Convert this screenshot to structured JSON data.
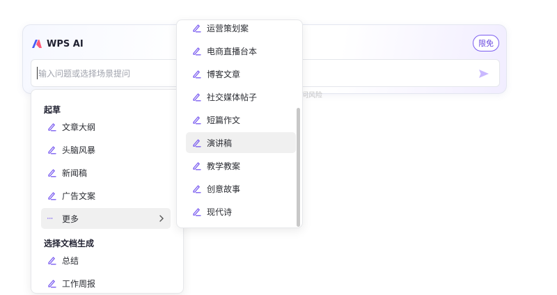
{
  "panel": {
    "brand": "WPS AI",
    "badge": "限免",
    "input_placeholder": "输入问题或选择场景提问",
    "hint_fragment": "问风险"
  },
  "main_menu": {
    "section1_title": "起草",
    "items": [
      "文章大纲",
      "头脑风暴",
      "新闻稿",
      "广告文案"
    ],
    "more_label": "更多",
    "section2_title": "选择文档生成",
    "doc_items": [
      "总结",
      "工作周报"
    ]
  },
  "sub_menu": {
    "items": [
      "运营策划案",
      "电商直播台本",
      "博客文章",
      "社交媒体帖子",
      "短篇作文",
      "演讲稿",
      "教学教案",
      "创意故事",
      "现代诗"
    ],
    "highlighted_index": 5
  },
  "colors": {
    "accent": "#7a5cf0",
    "send_icon": "#c9b8ff",
    "highlight_bg": "#f0f0f0"
  },
  "icons": {
    "brand": "wps-ai-logo-icon",
    "send": "send-arrow-icon",
    "item": "pen-icon",
    "more": "ellipsis-icon",
    "chevron": "chevron-right-icon"
  }
}
